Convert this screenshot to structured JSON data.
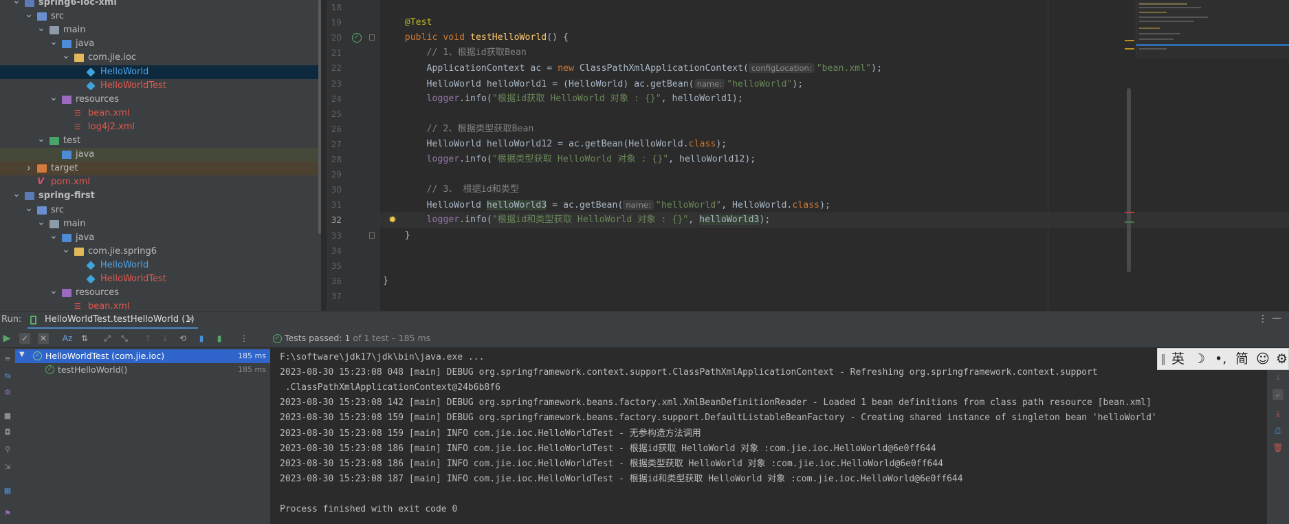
{
  "project_tree": {
    "items": [
      {
        "label": "spring6-ioc-xml",
        "icon": "module-icon",
        "depth": 1,
        "arrow": "expanded",
        "style": "bold"
      },
      {
        "label": "src",
        "icon": "src-folder-icon",
        "depth": 2,
        "arrow": "expanded",
        "style": "default"
      },
      {
        "label": "main",
        "icon": "folder-icon",
        "depth": 3,
        "arrow": "expanded",
        "style": "default"
      },
      {
        "label": "java",
        "icon": "java-source-icon",
        "depth": 4,
        "arrow": "expanded",
        "style": "default"
      },
      {
        "label": "com.jie.ioc",
        "icon": "package-icon",
        "depth": 5,
        "arrow": "expanded",
        "style": "default"
      },
      {
        "label": "HelloWorld",
        "icon": "class-icon",
        "depth": 6,
        "arrow": "none",
        "style": "blue",
        "selected": true
      },
      {
        "label": "HelloWorldTest",
        "icon": "class-icon",
        "depth": 6,
        "arrow": "none",
        "style": "red"
      },
      {
        "label": "resources",
        "icon": "resources-icon",
        "depth": 4,
        "arrow": "expanded",
        "style": "default"
      },
      {
        "label": "bean.xml",
        "icon": "xml-icon",
        "depth": 5,
        "arrow": "none",
        "style": "red"
      },
      {
        "label": "log4j2.xml",
        "icon": "xml-icon",
        "depth": 5,
        "arrow": "none",
        "style": "red"
      },
      {
        "label": "test",
        "icon": "test-folder-icon",
        "depth": 3,
        "arrow": "expanded",
        "style": "default"
      },
      {
        "label": "java",
        "icon": "java-source-icon",
        "depth": 4,
        "arrow": "none",
        "style": "default",
        "highlight": "green"
      },
      {
        "label": "target",
        "icon": "target-folder-icon",
        "depth": 2,
        "arrow": "collapsed",
        "style": "default",
        "highlight": "brown"
      },
      {
        "label": "pom.xml",
        "icon": "maven-icon",
        "depth": 2,
        "arrow": "none",
        "style": "red"
      },
      {
        "label": "spring-first",
        "icon": "module-icon",
        "depth": 1,
        "arrow": "expanded",
        "style": "bold"
      },
      {
        "label": "src",
        "icon": "src-folder-icon",
        "depth": 2,
        "arrow": "expanded",
        "style": "default"
      },
      {
        "label": "main",
        "icon": "folder-icon",
        "depth": 3,
        "arrow": "expanded",
        "style": "default"
      },
      {
        "label": "java",
        "icon": "java-source-icon",
        "depth": 4,
        "arrow": "expanded",
        "style": "default"
      },
      {
        "label": "com.jie.spring6",
        "icon": "package-icon",
        "depth": 5,
        "arrow": "expanded",
        "style": "default"
      },
      {
        "label": "HelloWorld",
        "icon": "class-icon",
        "depth": 6,
        "arrow": "none",
        "style": "blue"
      },
      {
        "label": "HelloWorldTest",
        "icon": "class-icon",
        "depth": 6,
        "arrow": "none",
        "style": "red"
      },
      {
        "label": "resources",
        "icon": "resources-icon",
        "depth": 4,
        "arrow": "expanded",
        "style": "default"
      },
      {
        "label": "bean.xml",
        "icon": "xml-icon",
        "depth": 5,
        "arrow": "none",
        "style": "red"
      }
    ]
  },
  "editor": {
    "line_numbers": [
      "18",
      "19",
      "20",
      "21",
      "22",
      "23",
      "24",
      "25",
      "26",
      "27",
      "28",
      "29",
      "30",
      "31",
      "32",
      "33",
      "34",
      "35",
      "36",
      "37"
    ],
    "lines": [
      [],
      [
        {
          "t": "    "
        },
        {
          "t": "@Test",
          "c": "ann"
        }
      ],
      [
        {
          "t": "    "
        },
        {
          "t": "public void ",
          "c": "kw"
        },
        {
          "t": "testHelloWorld",
          "c": "fn"
        },
        {
          "t": "() {",
          "c": "txt"
        }
      ],
      [
        {
          "t": "        "
        },
        {
          "t": "// 1、根据id获取Bean",
          "c": "cmt"
        }
      ],
      [
        {
          "t": "        "
        },
        {
          "t": "ApplicationContext ac = ",
          "c": "txt"
        },
        {
          "t": "new ",
          "c": "kw"
        },
        {
          "t": "ClassPathXmlApplicationContext(",
          "c": "txt"
        },
        {
          "t": "configLocation:",
          "c": "hint"
        },
        {
          "t": "\"bean.xml\"",
          "c": "str"
        },
        {
          "t": ");",
          "c": "txt"
        }
      ],
      [
        {
          "t": "        "
        },
        {
          "t": "HelloWorld helloWorld1 = (HelloWorld) ac.getBean(",
          "c": "txt"
        },
        {
          "t": "name:",
          "c": "hint"
        },
        {
          "t": "\"helloWorld\"",
          "c": "str"
        },
        {
          "t": ");",
          "c": "txt"
        }
      ],
      [
        {
          "t": "        "
        },
        {
          "t": "logger",
          "c": "field"
        },
        {
          "t": ".info(",
          "c": "txt"
        },
        {
          "t": "\"根据id获取 HelloWorld 对象 : {}\"",
          "c": "str"
        },
        {
          "t": ", helloWorld1);",
          "c": "txt"
        }
      ],
      [],
      [
        {
          "t": "        "
        },
        {
          "t": "// 2、根据类型获取Bean",
          "c": "cmt"
        }
      ],
      [
        {
          "t": "        "
        },
        {
          "t": "HelloWorld helloWorld12 = ac.getBean(HelloWorld.",
          "c": "txt"
        },
        {
          "t": "class",
          "c": "kw"
        },
        {
          "t": ");",
          "c": "txt"
        }
      ],
      [
        {
          "t": "        "
        },
        {
          "t": "logger",
          "c": "field"
        },
        {
          "t": ".info(",
          "c": "txt"
        },
        {
          "t": "\"根据类型获取 HelloWorld 对象 : {}\"",
          "c": "str"
        },
        {
          "t": ", helloWorld12);",
          "c": "txt"
        }
      ],
      [],
      [
        {
          "t": "        "
        },
        {
          "t": "// 3、 根据id和类型",
          "c": "cmt"
        }
      ],
      [
        {
          "t": "        "
        },
        {
          "t": "HelloWorld ",
          "c": "txt"
        },
        {
          "t": "helloWorld3",
          "c": "txt var-hl"
        },
        {
          "t": " = ac.getBean(",
          "c": "txt"
        },
        {
          "t": "name:",
          "c": "hint"
        },
        {
          "t": "\"helloWorld\"",
          "c": "str"
        },
        {
          "t": ", HelloWorld.",
          "c": "txt"
        },
        {
          "t": "class",
          "c": "kw"
        },
        {
          "t": ");",
          "c": "txt"
        }
      ],
      [
        {
          "t": "        "
        },
        {
          "t": "logger",
          "c": "field"
        },
        {
          "t": ".info(",
          "c": "txt"
        },
        {
          "t": "\"根据id和类型获取 HelloWorld 对象 : {}\"",
          "c": "str"
        },
        {
          "t": ", ",
          "c": "txt"
        },
        {
          "t": "helloWorld3",
          "c": "txt var-hl"
        },
        {
          "t": ");",
          "c": "txt"
        }
      ],
      [
        {
          "t": "    "
        },
        {
          "t": "}",
          "c": "txt"
        }
      ],
      [],
      [],
      [
        {
          "t": "}",
          "c": "txt"
        }
      ],
      []
    ]
  },
  "run": {
    "label": "Run:",
    "tab_title": "HelloWorldTest.testHelloWorld (1)",
    "status_prefix": "Tests passed:",
    "status_count": "1",
    "status_rest": "of 1 test – 185 ms",
    "tests": [
      {
        "name": "HelloWorldTest (com.jie.ioc)",
        "time": "185 ms"
      },
      {
        "name": "testHelloWorld()",
        "time": "185 ms"
      }
    ],
    "console": [
      "F:\\software\\jdk17\\jdk\\bin\\java.exe ...",
      "2023-08-30 15:23:08 048 [main] DEBUG org.springframework.context.support.ClassPathXmlApplicationContext - Refreshing org.springframework.context.support",
      " .ClassPathXmlApplicationContext@24b6b8f6",
      "2023-08-30 15:23:08 142 [main] DEBUG org.springframework.beans.factory.xml.XmlBeanDefinitionReader - Loaded 1 bean definitions from class path resource [bean.xml]",
      "2023-08-30 15:23:08 159 [main] DEBUG org.springframework.beans.factory.support.DefaultListableBeanFactory - Creating shared instance of singleton bean 'helloWorld'",
      "2023-08-30 15:23:08 159 [main] INFO com.jie.ioc.HelloWorldTest - 无参构造方法调用",
      "2023-08-30 15:23:08 186 [main] INFO com.jie.ioc.HelloWorldTest - 根据id获取 HelloWorld 对象 :com.jie.ioc.HelloWorld@6e0ff644",
      "2023-08-30 15:23:08 186 [main] INFO com.jie.ioc.HelloWorldTest - 根据类型获取 HelloWorld 对象 :com.jie.ioc.HelloWorld@6e0ff644",
      "2023-08-30 15:23:08 187 [main] INFO com.jie.ioc.HelloWorldTest - 根据id和类型获取 HelloWorld 对象 :com.jie.ioc.HelloWorld@6e0ff644",
      "",
      "Process finished with exit code 0"
    ]
  },
  "ime": {
    "lang": "英",
    "punct": "•,",
    "script": "简"
  },
  "colors": {
    "accent_blue": "#4fa3e8",
    "vcs_red": "#e0574f",
    "pass_green": "#59a869",
    "selection": "#0d293e"
  }
}
